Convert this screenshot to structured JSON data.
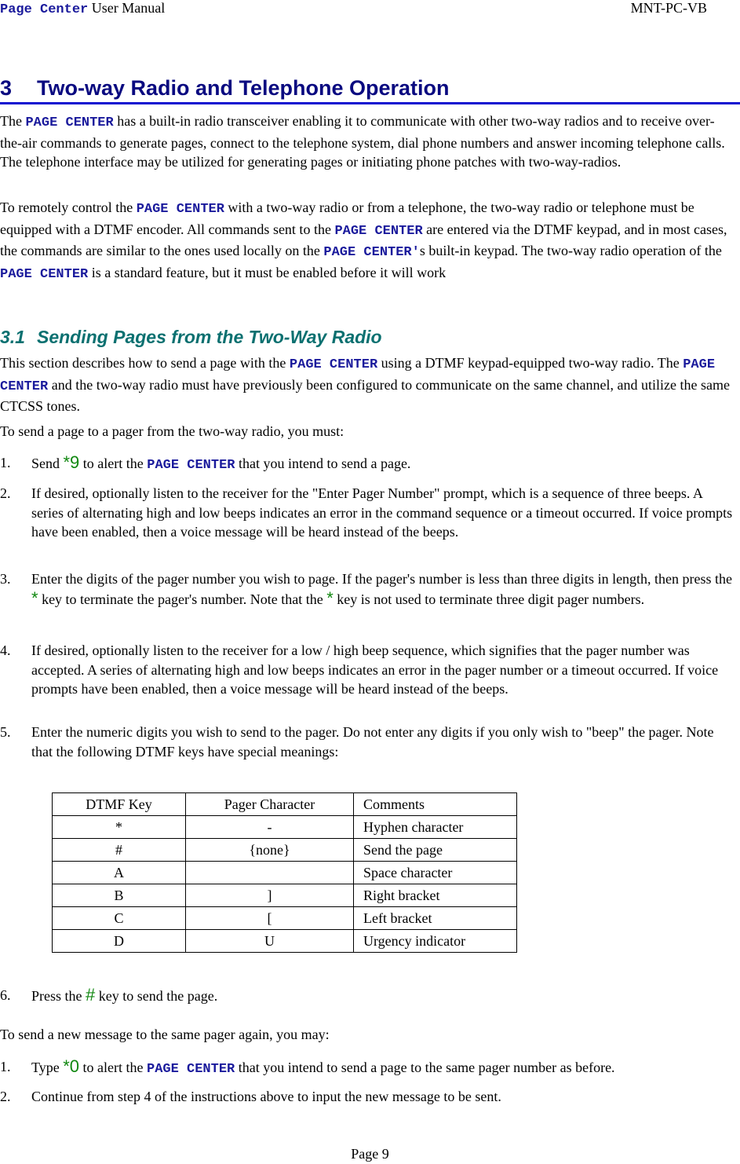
{
  "header": {
    "brand": "Page Center",
    "title_suffix": " User Manual",
    "doc_id": "MNT-PC-VB"
  },
  "colors": {
    "brand_text": "#1a1a9c",
    "heading1": "#0a0a80",
    "heading1_rule": "#1010d0",
    "heading2": "#0a7070",
    "dtmf_key": "#118811"
  },
  "section3": {
    "number": "3",
    "title": "Two-way Radio and Telephone Operation",
    "intro_p1": {
      "a": "The ",
      "pc": "PAGE CENTER",
      "b": " has a built-in radio transceiver enabling it to communicate with other two-way radios and to receive over-the-air commands to generate pages, connect to the telephone system, dial phone numbers and answer incoming telephone calls.  The telephone interface may be utilized for generating pages or initiating phone patches with two-way-radios."
    },
    "intro_p2": {
      "a": "To remotely control the ",
      "pc1": "PAGE CENTER",
      "b": " with a two-way radio or from a telephone, the two-way radio or telephone must be equipped with a DTMF encoder.  All commands sent to the ",
      "pc2": "PAGE CENTER",
      "c": " are entered via the DTMF keypad, and in most cases, the commands are similar to the ones used locally on the ",
      "pc3": "PAGE CENTER'",
      "d": "s built-in keypad. The two-way radio operation of the ",
      "pc4": "PAGE CENTER",
      "e": " is a standard feature, but it must be enabled before it will work"
    }
  },
  "section31": {
    "number": "3.1",
    "title": "Sending Pages from the Two-Way Radio",
    "p1": {
      "a": "This section describes how to send a page with the ",
      "pc1": "PAGE CENTER",
      "b": " using a DTMF keypad-equipped two-way radio.   The ",
      "pc2": "PAGE CENTER",
      "c": " and the two-way radio must have previously been configured to communicate on the same channel, and utilize the same CTCSS tones."
    },
    "p2": "To send a page to a pager from the two-way radio, you must:",
    "steps": [
      {
        "n": "1.",
        "a": "Send ",
        "key": "*9",
        "b": "  to alert the ",
        "pc": "PAGE CENTER",
        "c": " that you intend to send a page."
      },
      {
        "n": "2.",
        "text": "If desired, optionally listen to the receiver for the \"Enter Pager Number\" prompt, which is a sequence of three beeps.  A series of alternating high and low beeps indicates an error in the command sequence or a timeout occurred. If voice prompts have been enabled, then a voice message will be heard instead of the beeps."
      },
      {
        "n": "3.",
        "a": "Enter the digits of the pager number you wish to page.  If the pager's number is less than three digits in length, then press the ",
        "key1": "*",
        "b": " key to terminate the pager's number.  Note that the ",
        "key2": "*",
        "c": " key is not used to terminate three digit pager numbers."
      },
      {
        "n": "4.",
        "text": "If desired, optionally listen to the receiver for a low / high beep sequence, which signifies that the pager number was accepted.  A series of alternating high and low beeps indicates an error in the pager number or a timeout occurred. If voice prompts have been enabled, then a voice message will be heard instead of the beeps."
      },
      {
        "n": "5.",
        "text": "Enter the numeric digits you wish to send to the pager.  Do not enter any digits if you only wish to \"beep\" the pager.  Note that the following DTMF keys have special meanings:"
      },
      {
        "n": "6.",
        "a": "Press the ",
        "key": "#",
        "b": "  key to send the page."
      }
    ],
    "table": {
      "headers": [
        "DTMF Key",
        "Pager Character",
        "Comments"
      ],
      "rows": [
        [
          "*",
          "-",
          "Hyphen character"
        ],
        [
          "#",
          "{none}",
          "Send the page"
        ],
        [
          "A",
          "",
          "Space character"
        ],
        [
          "B",
          "]",
          "Right bracket"
        ],
        [
          "C",
          "[",
          "Left bracket"
        ],
        [
          "D",
          "U",
          "Urgency indicator"
        ]
      ]
    },
    "p3": "To send a new message to the same pager again, you may:",
    "resend_steps": [
      {
        "n": "1.",
        "a": "Type ",
        "key": "*0",
        "b": "  to alert the ",
        "pc": "PAGE CENTER",
        "c": " that you intend to send a page to the same pager number as before."
      },
      {
        "n": "2.",
        "text": "Continue from step 4 of the instructions above to input the new message to be sent."
      }
    ]
  },
  "footer": {
    "page": "Page 9"
  }
}
